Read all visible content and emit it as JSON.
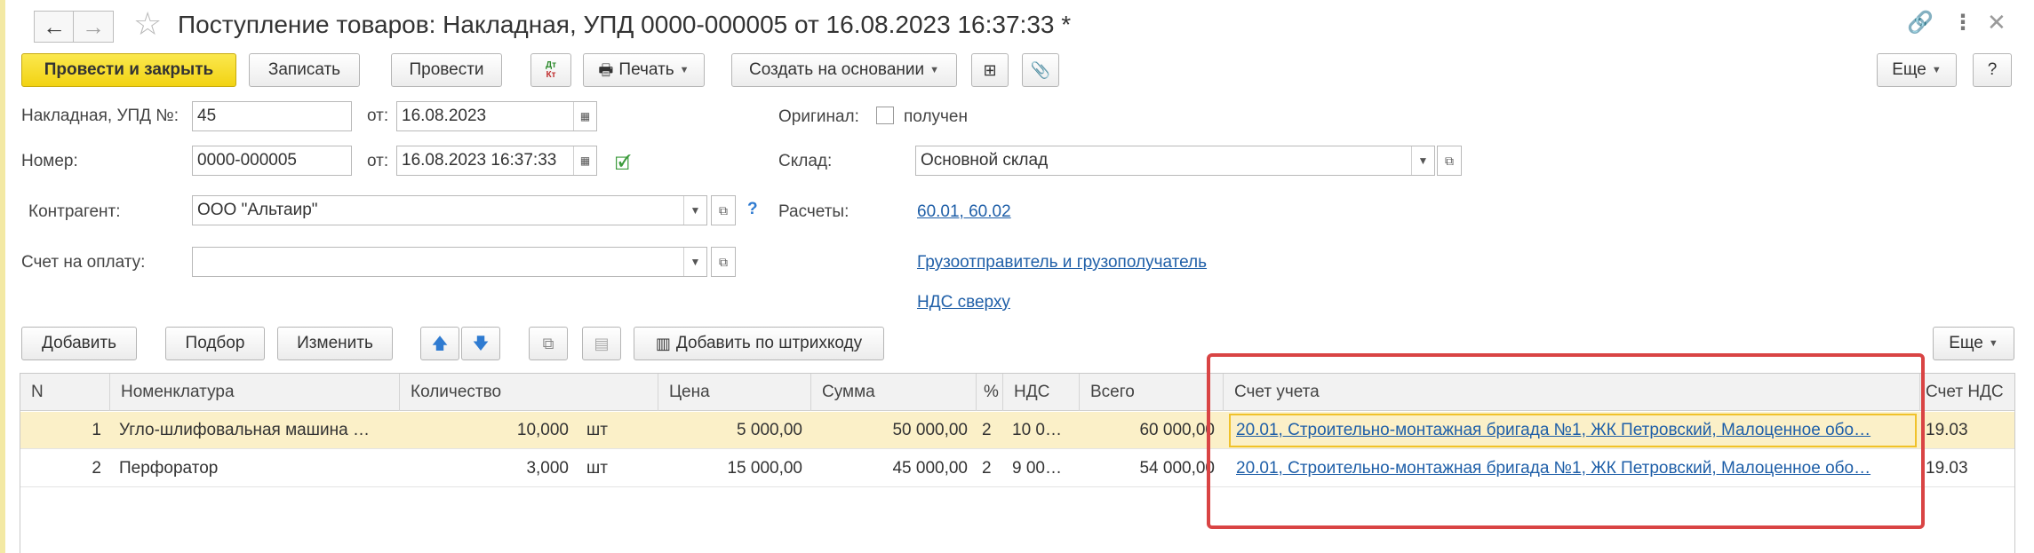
{
  "window": {
    "title": "Поступление товаров: Накладная, УПД 0000-000005 от 16.08.2023 16:37:33 *",
    "back_icon": "arrow-left-icon",
    "forward_icon": "arrow-right-icon",
    "favorite_icon": "star-icon",
    "link_icon": "link-icon",
    "menu_icon": "more-vertical-icon",
    "close_icon": "close-icon"
  },
  "toolbar": {
    "post_close": "Провести и закрыть",
    "save": "Записать",
    "post": "Провести",
    "dtkt": "Дт Кт",
    "print": "Печать",
    "create_based": "Создать на основании",
    "more": "Еще",
    "help": "?"
  },
  "form": {
    "invoice_label": "Накладная, УПД №:",
    "invoice_number": "45",
    "from_label": "от:",
    "invoice_date": "16.08.2023",
    "number_label": "Номер:",
    "number_value": "0000-000005",
    "number_date": "16.08.2023 16:37:33",
    "counterparty_label": "Контрагент:",
    "counterparty_value": "ООО \"Альтаир\"",
    "help_mark": "?",
    "payment_invoice_label": "Счет на оплату:",
    "payment_invoice_value": "",
    "original_label": "Оригинал:",
    "original_received": "получен",
    "warehouse_label": "Склад:",
    "warehouse_value": "Основной склад",
    "settlements_label": "Расчеты:",
    "settlements_link": "60.01, 60.02",
    "shipper_link": "Грузоотправитель и грузополучатель",
    "vat_link": "НДС сверху"
  },
  "table_toolbar": {
    "add": "Добавить",
    "selection": "Подбор",
    "edit": "Изменить",
    "add_barcode": "Добавить по штрихкоду",
    "more": "Еще"
  },
  "table": {
    "headers": {
      "n": "N",
      "item": "Номенклатура",
      "qty": "Количество",
      "price": "Цена",
      "sum": "Сумма",
      "pct": "%",
      "vat": "НДС",
      "total": "Всего",
      "account": "Счет учета",
      "vat_account": "Счет НДС"
    },
    "rows": [
      {
        "n": "1",
        "item": "Угло-шлифовальная машина …",
        "qty": "10,000",
        "unit": "шт",
        "price": "5 000,00",
        "sum": "50 000,00",
        "pct": "2",
        "vat": "10 0…",
        "total": "60 000,00",
        "account": "20.01, Строительно-монтажная бригада №1, ЖК Петровский, Малоценное обо…",
        "vat_account": "19.03"
      },
      {
        "n": "2",
        "item": "Перфоратор",
        "qty": "3,000",
        "unit": "шт",
        "price": "15 000,00",
        "sum": "45 000,00",
        "pct": "2",
        "vat": "9 00…",
        "total": "54 000,00",
        "account": "20.01, Строительно-монтажная бригада №1, ЖК Петровский, Малоценное обо…",
        "vat_account": "19.03"
      }
    ]
  },
  "colors": {
    "accent_yellow": "#f5da2a",
    "link_blue": "#1f5fa8",
    "highlight_red": "#d94444",
    "selected_row": "#fbf0c8"
  }
}
